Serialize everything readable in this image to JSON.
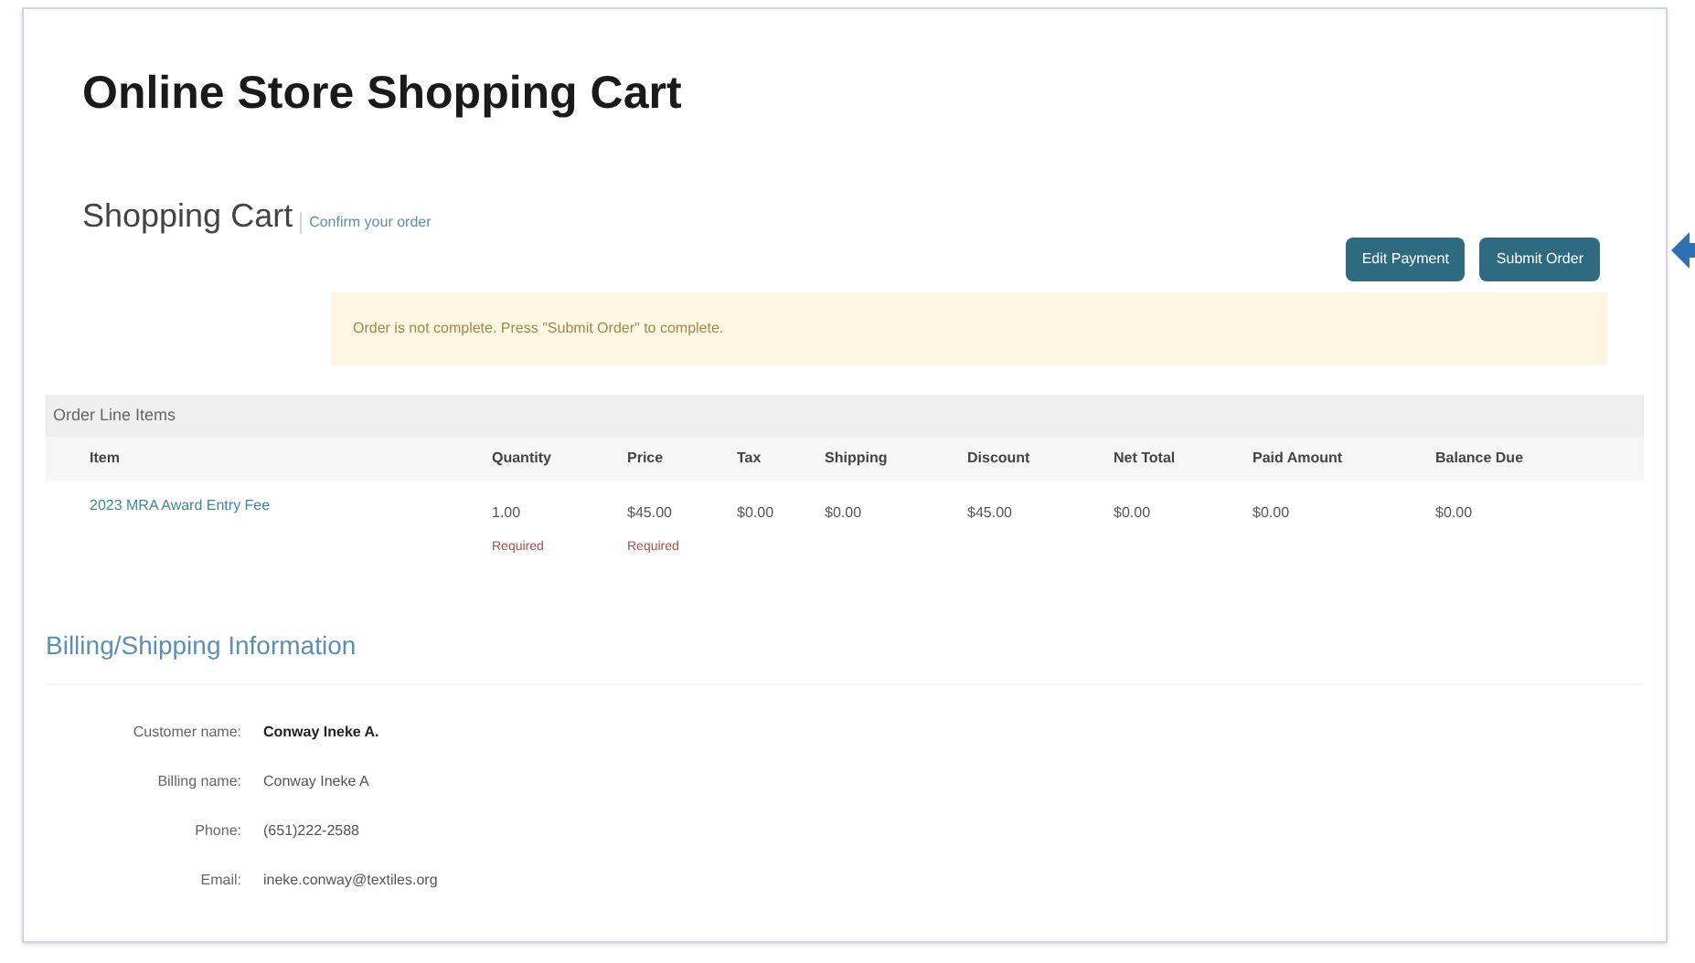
{
  "page_title": "Online Store Shopping Cart",
  "section": {
    "title": "Shopping Cart",
    "subtitle": "Confirm your order"
  },
  "buttons": [
    "Edit Payment",
    "Submit Order"
  ],
  "alert": "Order is not complete. Press \"Submit Order\" to complete.",
  "table": {
    "caption": "Order Line Items",
    "columns": [
      "Item",
      "Quantity",
      "Price",
      "Tax",
      "Shipping",
      "Discount",
      "Net Total",
      "Paid Amount",
      "Balance Due"
    ],
    "rows": [
      [
        {
          "text": "2023 MRA Award Entry Fee",
          "kind": "link"
        },
        {
          "text": "1.00",
          "note": "Required"
        },
        {
          "text": "$45.00",
          "note": "Required"
        },
        {
          "text": "$0.00"
        },
        {
          "text": "$0.00"
        },
        {
          "text": "$45.00"
        },
        {
          "text": "$0.00"
        },
        {
          "text": "$0.00"
        },
        {
          "text": "$0.00"
        }
      ]
    ]
  },
  "billing": {
    "title": "Billing/Shipping Information",
    "fields": [
      {
        "label": "Customer name:",
        "value": "Conway Ineke A.",
        "bold": true
      },
      {
        "label": "Billing name:",
        "value": "Conway Ineke A",
        "bold": false
      },
      {
        "label": "Phone:",
        "value": "(651)222-2588",
        "bold": false
      },
      {
        "label": "Email:",
        "value": "ineke.conway@textiles.org",
        "bold": false
      }
    ]
  }
}
